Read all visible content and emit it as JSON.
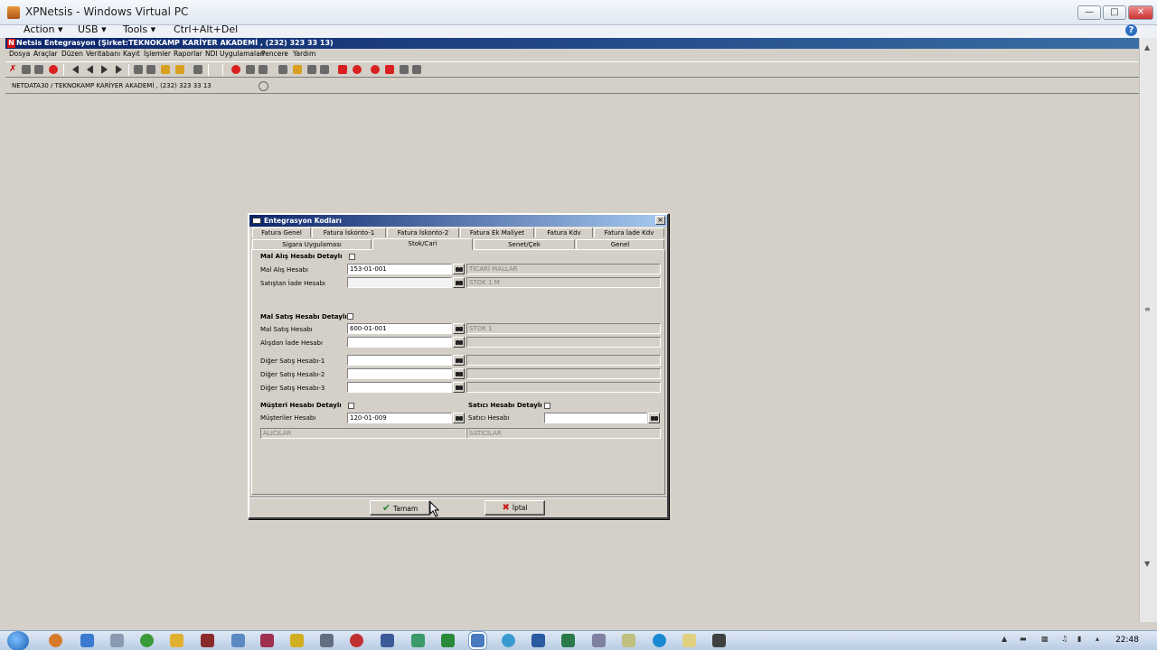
{
  "vpc": {
    "title": "XPNetsis - Windows Virtual PC",
    "menu": [
      "Action ▾",
      "USB ▾",
      "Tools ▾",
      "Ctrl+Alt+Del"
    ],
    "help": "?"
  },
  "app": {
    "title": "Netsis Entegrasyon (Şirket:TEKNOKAMP KARİYER AKADEMİ , (232) 323 33 13)",
    "menu": [
      "Dosya",
      "Araçlar",
      "Düzen",
      "Veritabanı",
      "Kayıt",
      "İşlemler",
      "Raporlar",
      "NDI Uygulamaları",
      "Pencere",
      "Yardım"
    ],
    "company_combo": "NETDATA30 / TEKNOKAMP KARİYER AKADEMİ , (232) 323 33 13"
  },
  "dialog": {
    "title": "Entegrasyon Kodları",
    "close": "×",
    "tabs_row1": [
      "Fatura Genel",
      "Fatura İskonto-1",
      "Fatura İskonto-2",
      "Fatura Ek Maliyet",
      "Fatura Kdv",
      "Fatura İade Kdv"
    ],
    "tabs_row2": [
      "Sigara Uygulaması",
      "Stok/Cari",
      "Senet/Çek",
      "Genel"
    ],
    "mal_alis": {
      "header": "Mal Alış Hesabı Detaylı",
      "hesap_label": "Mal Alış Hesabı",
      "hesap_value": "153-01-001",
      "hesap_desc": "TİCARİ MALLAR",
      "iade_label": "Satıştan İade Hesabı",
      "iade_value": "",
      "iade_desc": "STOK 1.M"
    },
    "mal_satis": {
      "header": "Mal Satış Hesabı Detaylı",
      "hesap_label": "Mal Satış Hesabı",
      "hesap_value": "600-01-001",
      "hesap_desc": "STOK 1",
      "iade_label": "Alışdan İade Hesabı",
      "diger1_label": "Diğer Satış Hesabı-1",
      "diger2_label": "Diğer Satış Hesabı-2",
      "diger3_label": "Diğer Satış Hesabı-3"
    },
    "musteri": {
      "header": "Müşteri Hesabı Detaylı",
      "hesap_label": "Müşteriler Hesabı",
      "hesap_value": "120-01-009",
      "desc": "ALICILAR"
    },
    "satici": {
      "header": "Satıcı Hesabı Detaylı",
      "hesap_label": "Satıcı Hesabı",
      "hesap_value": "",
      "desc": "SATICILAR"
    },
    "ok": "Tamam",
    "cancel": "İptal"
  },
  "taskbar": {
    "clock": "22:48"
  }
}
